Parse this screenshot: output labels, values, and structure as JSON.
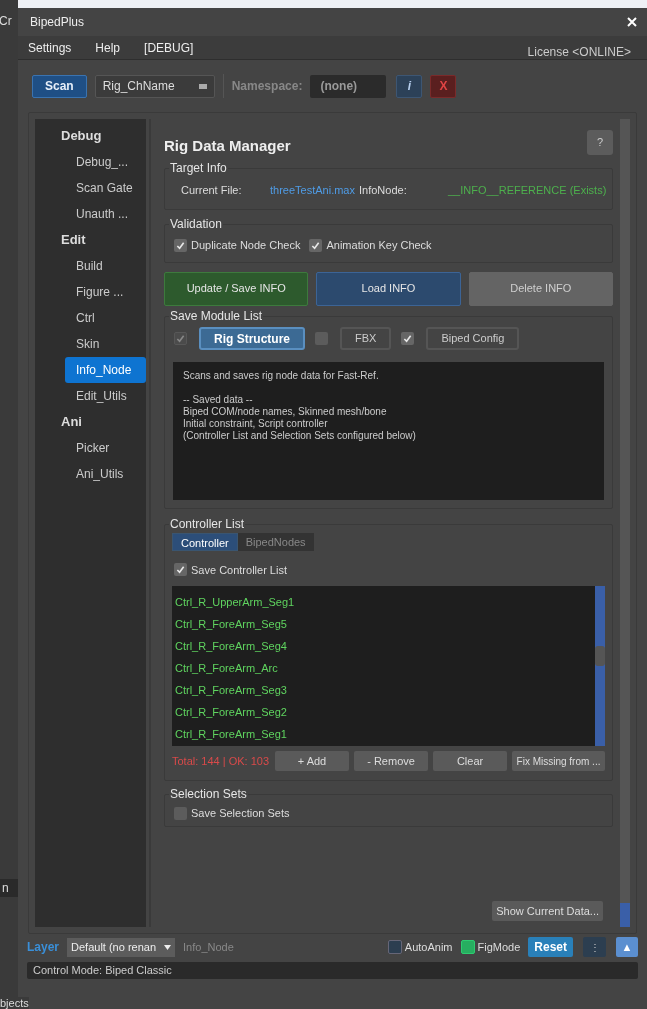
{
  "background_app": {
    "texts": [
      "Cr",
      "n",
      "bjects"
    ]
  },
  "window": {
    "title": "BipedPlus"
  },
  "menu": [
    "Settings",
    "Help",
    "[DEBUG]"
  ],
  "license": "License <ONLINE>",
  "toolbar": {
    "scan": "Scan",
    "rig_field": "Rig_ChName",
    "namespace_label": "Namespace:",
    "namespace_value": "(none)",
    "info": "i",
    "close": "X"
  },
  "sidebar": [
    {
      "label": "Debug",
      "children": [
        {
          "label": "Debug_...",
          "selected": false
        },
        {
          "label": "Scan Gate",
          "selected": false
        },
        {
          "label": "Unauth ...",
          "selected": false
        }
      ]
    },
    {
      "label": "Edit",
      "children": [
        {
          "label": "Build",
          "selected": false
        },
        {
          "label": "Figure ...",
          "selected": false
        },
        {
          "label": "Ctrl",
          "selected": false
        },
        {
          "label": "Skin",
          "selected": false
        },
        {
          "label": "Info_Node",
          "selected": true
        },
        {
          "label": "Edit_Utils",
          "selected": false
        }
      ]
    },
    {
      "label": "Ani",
      "children": [
        {
          "label": "Picker",
          "selected": false
        },
        {
          "label": "Ani_Utils",
          "selected": false
        }
      ]
    }
  ],
  "panel": {
    "title": "Rig Data Manager",
    "help": "?",
    "target_info": {
      "title": "Target Info",
      "current_file_label": "Current File:",
      "current_file": "threeTestAni.max",
      "infonode_label": "InfoNode:",
      "infonode": "__INFO__REFERENCE (Exists)"
    },
    "validation": {
      "title": "Validation",
      "checks": [
        {
          "label": "Duplicate Node Check",
          "checked": true
        },
        {
          "label": "Animation Key Check",
          "checked": true
        }
      ]
    },
    "actions": [
      {
        "label": "Update / Save INFO",
        "kind": "update"
      },
      {
        "label": "Load INFO",
        "kind": "load"
      },
      {
        "label": "Delete INFO",
        "kind": "delete"
      }
    ],
    "save_modules": {
      "title": "Save Module List",
      "modules": [
        {
          "label": "Rig Structure",
          "checked": true,
          "disabled": true,
          "selected": true
        },
        {
          "label": "FBX",
          "checked": false,
          "disabled": false,
          "selected": false
        },
        {
          "label": "Biped Config",
          "checked": true,
          "disabled": false,
          "selected": false
        }
      ],
      "description": {
        "intro": "Scans and saves rig node data for Fast-Ref.",
        "lines": [
          "-- Saved data --",
          "Biped COM/node names, Skinned mesh/bone",
          "Initial constraint, Script controller",
          "(Controller List and Selection Sets configured below)"
        ]
      }
    },
    "controller_list": {
      "title": "Controller List",
      "tabs": [
        {
          "label": "Controller",
          "selected": true
        },
        {
          "label": "BipedNodes",
          "selected": false
        }
      ],
      "save": {
        "label": "Save Controller List",
        "checked": true
      },
      "items": [
        "Ctrl_R_UpperArm_Seg1",
        "Ctrl_R_ForeArm_Seg5",
        "Ctrl_R_ForeArm_Seg4",
        "Ctrl_R_ForeArm_Arc",
        "Ctrl_R_ForeArm_Seg3",
        "Ctrl_R_ForeArm_Seg2",
        "Ctrl_R_ForeArm_Seg1"
      ],
      "total": "Total: 144 | OK: 103",
      "buttons": [
        "+ Add",
        "- Remove",
        "Clear",
        "Fix Missing from ..."
      ]
    },
    "selection_sets": {
      "title": "Selection Sets",
      "save": {
        "label": "Save Selection Sets",
        "checked": false
      }
    },
    "show_data": "Show Current Data..."
  },
  "bottom": {
    "layer_label": "Layer",
    "layer_value": "Default (no renan",
    "page": "Info_Node",
    "toggles": [
      {
        "label": "AutoAnim",
        "on": false
      },
      {
        "label": "FigMode",
        "on": true
      }
    ],
    "reset": "Reset",
    "more": "⋮",
    "up": "▲"
  },
  "status": "Control Mode: Biped Classic"
}
